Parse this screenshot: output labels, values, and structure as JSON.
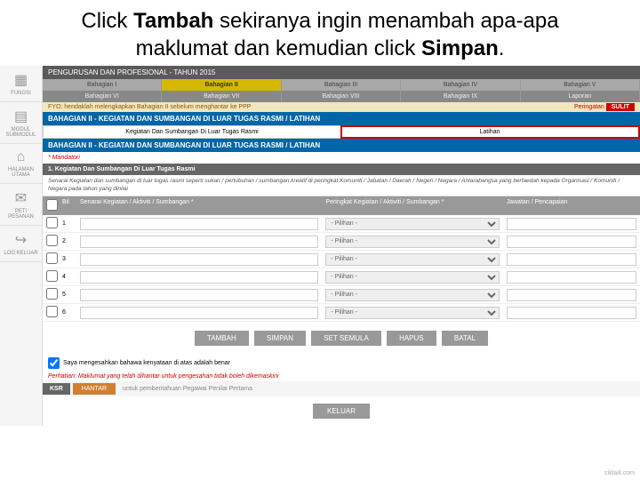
{
  "instruction": {
    "pre1": "Click ",
    "bold1": "Tambah",
    "mid1": " sekiranya ingin menambah apa-apa maklumat dan kemudian click ",
    "bold2": "Simpan",
    "post": "."
  },
  "sidebar": {
    "items": [
      {
        "icon": "▦",
        "label": "FUNGSI"
      },
      {
        "icon": "▤",
        "label": "MODUL SUBMODUL"
      },
      {
        "icon": "⌂",
        "label": "HALAMAN UTAMA"
      },
      {
        "icon": "✉",
        "label": "PETI PESANAN"
      },
      {
        "icon": "↪",
        "label": "LOG KELUAR"
      }
    ]
  },
  "titlebar": "PENGURUSAN DAN PROFESIONAL - TAHUN 2015",
  "tabs1": [
    "Bahagian I",
    "Bahagian II",
    "Bahagian III",
    "Bahagian IV",
    "Bahagian V"
  ],
  "tabs2": [
    "Bahagian VI",
    "Bahagian VII",
    "Bahagian VIII",
    "Bahagian IX",
    "Laporan"
  ],
  "tabs_active": 1,
  "fyo": {
    "text": "FYO: hendaklah melengkapkan Bahagian II sebelum menghantar ke PPP",
    "warn": "Peringatan",
    "sulit": "SULIT"
  },
  "section_hdr": "BAHAGIAN II - KEGIATAN DAN SUMBANGAN DI LUAR TUGAS RASMI / LATIHAN",
  "subtabs": [
    "Kegiatan Dan Sumbangan Di Luar Tugas Rasmi",
    "Latihan"
  ],
  "mandatory": "* Mandatori",
  "subsection": "1. Kegiatan Dan Sumbangan Di Luar Tugas Rasmi",
  "desc": "Senarai Kegiatan dan sumbangan di luar tugas rasmi seperti sukan / pertubuhan / sumbangan kreatif di peringkat Komuniti / Jabatan / Daerah / Negeri / Negara / Antarabangsa yang berfaedah kepada Organisasi / Komuniti / Negara pada tahun yang dinilai",
  "table": {
    "headers": {
      "bil": "Bil",
      "sen": "Senarai Kegiatan / Aktiviti / Sumbangan *",
      "per": "Peringkat Kegiatan / Aktiviti / Sumbangan *",
      "jaw": "Jawatan / Pencapaian"
    },
    "placeholder": "- Pilihan -",
    "rows": [
      1,
      2,
      3,
      4,
      5,
      6
    ]
  },
  "buttons": {
    "tambah": "TAMBAH",
    "simpan": "SIMPAN",
    "set": "SET SEMULA",
    "hapus": "HAPUS",
    "batal": "BATAL"
  },
  "confirm": "Saya mengesahkan bahawa kenyataan di atas adalah benar",
  "warn": "Perhatian: Maklumat yang telah dihantar untuk pengesahan tidak boleh dikemaskini",
  "ksr": {
    "label": "KSR",
    "btn": "HANTAR",
    "note": "untuk pemberitahuan Pegawai Penilai Pertama"
  },
  "keluar": "KELUAR",
  "brand": "ciklaili.com"
}
